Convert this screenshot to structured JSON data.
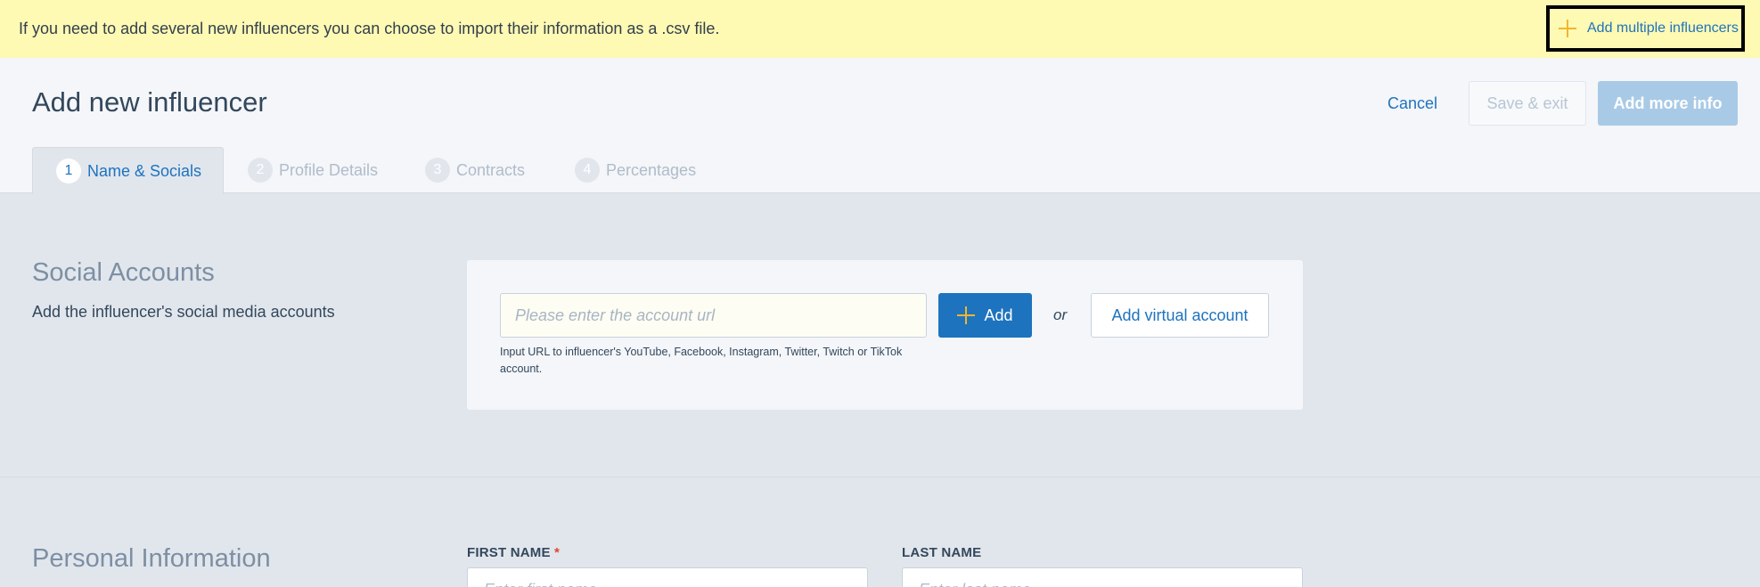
{
  "banner": {
    "text": "If you need to add several new influencers you can choose to import their information as a .csv file.",
    "multi_label": "Add multiple influencers"
  },
  "header": {
    "title": "Add new influencer",
    "cancel_label": "Cancel",
    "save_label": "Save & exit",
    "more_label": "Add more info"
  },
  "tabs": [
    {
      "num": "1",
      "label": "Name & Socials"
    },
    {
      "num": "2",
      "label": "Profile Details"
    },
    {
      "num": "3",
      "label": "Contracts"
    },
    {
      "num": "4",
      "label": "Percentages"
    }
  ],
  "social": {
    "title": "Social Accounts",
    "desc": "Add the influencer's social media accounts",
    "placeholder": "Please enter the account url",
    "helper": "Input URL to influencer's YouTube, Facebook, Instagram, Twitter, Twitch or TikTok account.",
    "add_label": "Add",
    "or": "or",
    "virtual_label": "Add virtual account"
  },
  "personal": {
    "title": "Personal Information",
    "first_label": "FIRST NAME",
    "required_mark": "*",
    "first_placeholder": "Enter first name",
    "last_label": "LAST NAME",
    "last_placeholder": "Enter last name"
  },
  "colors": {
    "accent": "#1e73be",
    "banner": "#fef9b3",
    "plus_icon": "#f2b531"
  }
}
